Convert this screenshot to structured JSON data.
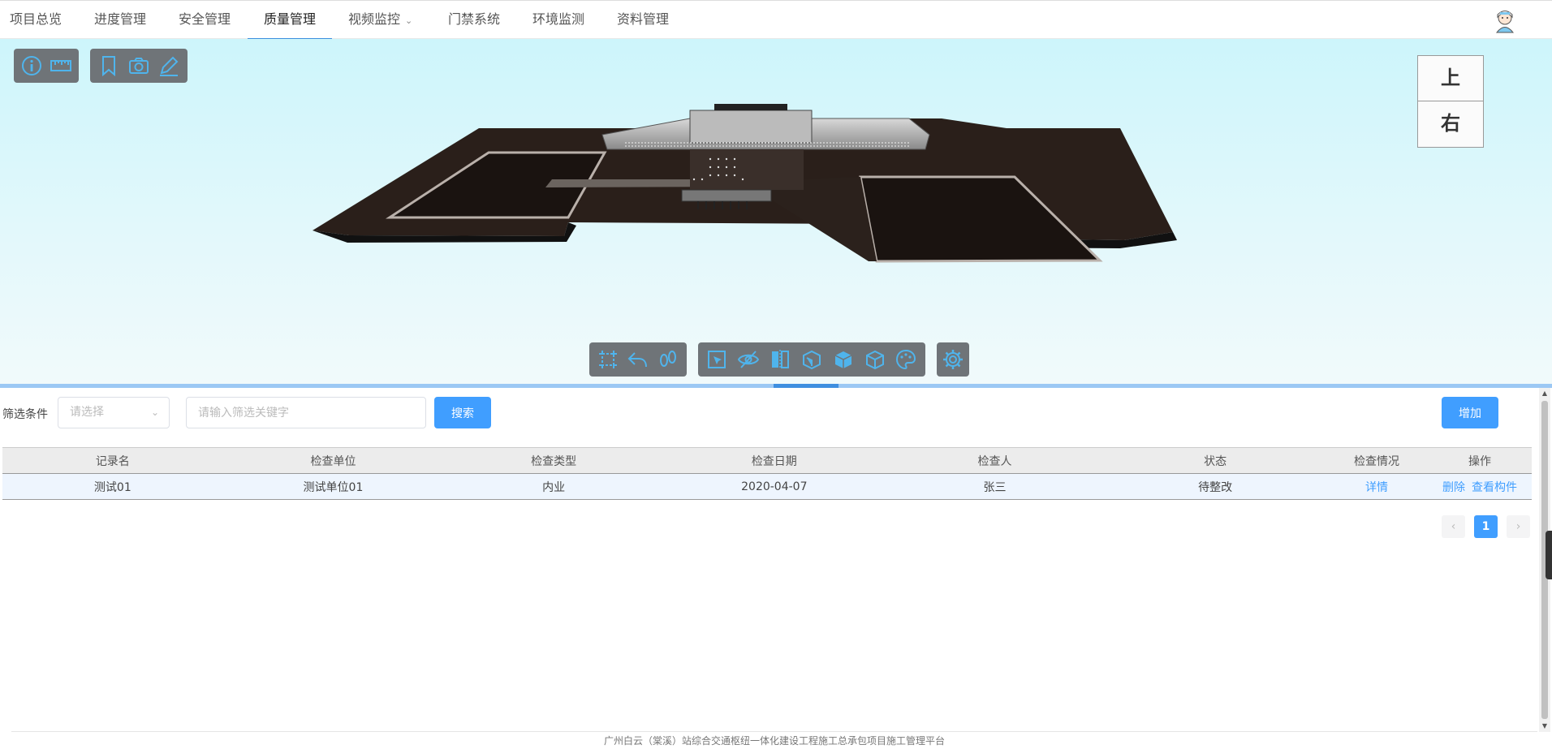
{
  "nav": {
    "items": [
      "项目总览",
      "进度管理",
      "安全管理",
      "质量管理",
      "视频监控",
      "门禁系统",
      "环境监测",
      "资料管理"
    ],
    "active": "质量管理"
  },
  "viewer": {
    "top_left_tools_a": [
      "info-icon",
      "ruler-icon"
    ],
    "top_left_tools_b": [
      "bookmark-icon",
      "camera-icon",
      "pencil-icon"
    ],
    "bottom_tools_a": [
      "zoom-extent-icon",
      "undo-icon",
      "footprint-icon"
    ],
    "bottom_tools_b": [
      "box-select-icon",
      "hide-icon",
      "section-icon",
      "explode-icon",
      "isolate-icon",
      "wireframe-icon",
      "palette-icon"
    ],
    "bottom_tools_c": [
      "settings-icon"
    ],
    "viewcube": {
      "top": "上",
      "right": "右"
    }
  },
  "filter": {
    "label": "筛选条件",
    "select_placeholder": "请选择",
    "keyword_placeholder": "请输入筛选关键字",
    "search_button": "搜索",
    "add_button": "增加"
  },
  "table": {
    "headers": [
      "记录名",
      "检查单位",
      "检查类型",
      "检查日期",
      "检查人",
      "状态",
      "检查情况",
      "操作"
    ],
    "rows": [
      {
        "name": "测试01",
        "unit": "测试单位01",
        "type": "内业",
        "date": "2020-04-07",
        "inspector": "张三",
        "status": "待整改",
        "detail": "详情",
        "delete": "删除",
        "view_component": "查看构件"
      }
    ]
  },
  "pagination": {
    "current": "1",
    "prev": "‹",
    "next": "›"
  },
  "footer": "广州白云（棠溪）站综合交通枢纽一体化建设工程施工总承包项目施工管理平台",
  "colors": {
    "accent": "#409eff",
    "nav_active_underline": "#3b8fde",
    "toolbar_bg": "#6f7478",
    "icon": "#4fb4ec"
  }
}
